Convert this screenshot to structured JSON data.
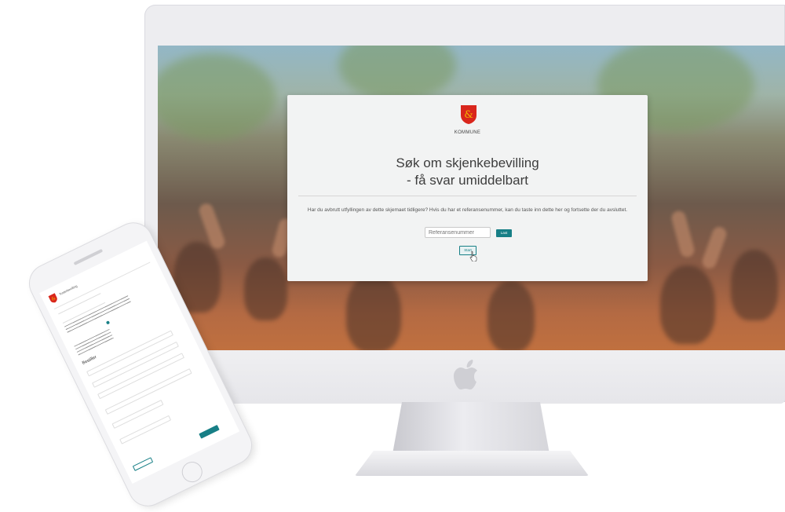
{
  "desktop": {
    "municipality_label": "KOMMUNE",
    "title_line1": "Søk om skjenkebevilling",
    "title_line2": "- få svar umiddelbart",
    "lead_text": "Har du avbrutt utfyllingen av dette skjemaet tidligere? Hvis du har et referansenummer, kan du taste inn dette her og fortsette der du avsluttet.",
    "reference_input_placeholder": "Referansenummer",
    "load_button_label": "Last",
    "start_button_label": "Start"
  },
  "colors": {
    "accent": "#177f86",
    "card_background": "#f2f3f3",
    "crest_red": "#d9261c",
    "crest_gold": "#f2b500"
  },
  "icons": {
    "crest": "municipal-crest-icon",
    "apple": "apple-logo-icon",
    "cursor": "hand-pointer-cursor-icon"
  },
  "phone": {
    "header": "Tosterbevilling",
    "section_heading": "Bestiller"
  }
}
